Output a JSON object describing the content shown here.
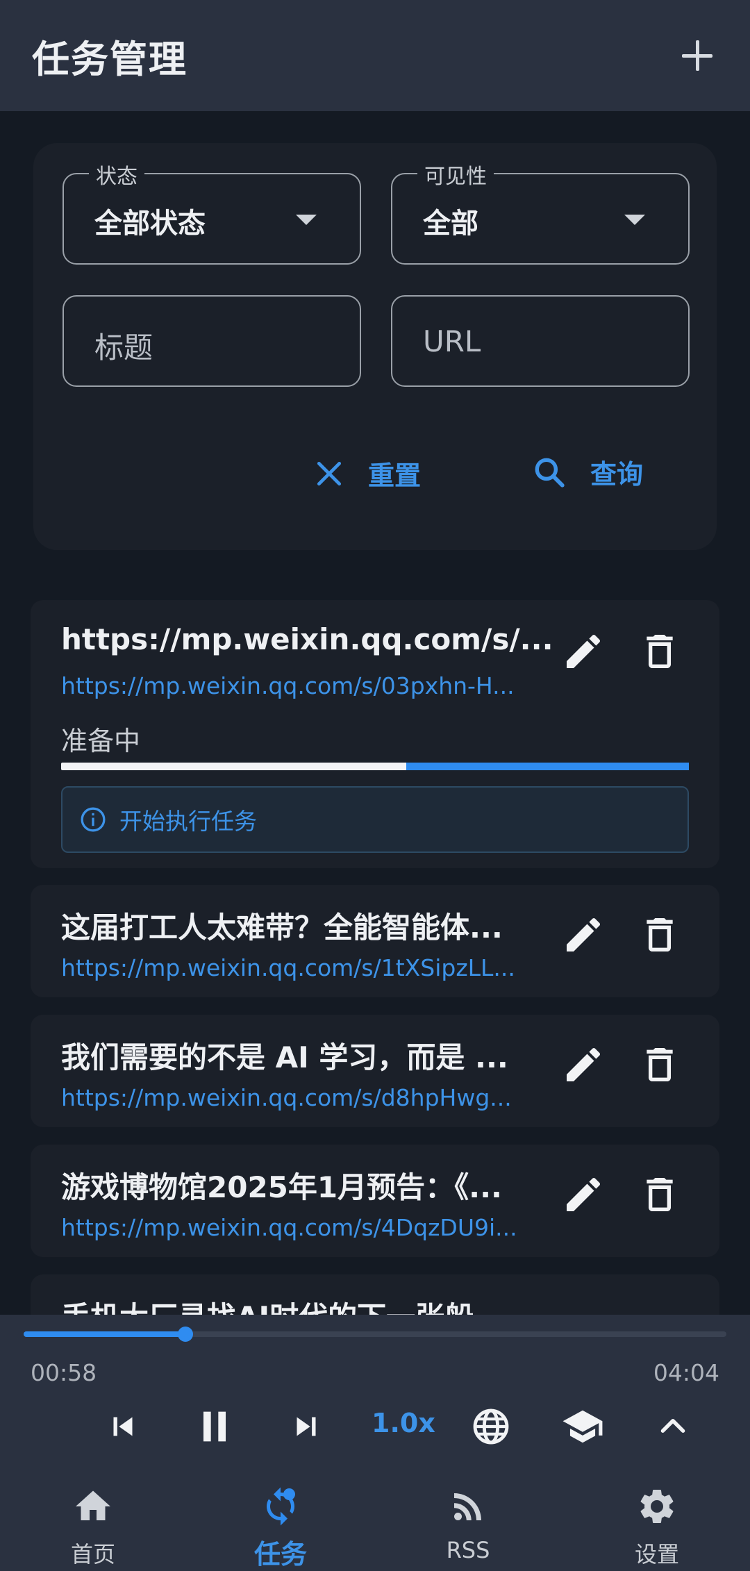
{
  "header": {
    "title": "任务管理",
    "add_icon": "plus-icon"
  },
  "filters": {
    "status": {
      "label": "状态",
      "value": "全部状态"
    },
    "visibility": {
      "label": "可见性",
      "value": "全部"
    },
    "title_input": {
      "placeholder": "标题"
    },
    "url_input": {
      "placeholder": "URL"
    },
    "reset_label": "重置",
    "search_label": "查询"
  },
  "tasks": [
    {
      "title": "https://mp.weixin.qq.com/s/...",
      "url": "https://mp.weixin.qq.com/s/03pxhn-H...",
      "status": "准备中",
      "progress": 0.55,
      "message": "开始执行任务"
    },
    {
      "title": "这届打工人太难带？全能智能体...",
      "url": "https://mp.weixin.qq.com/s/1tXSipzLL..."
    },
    {
      "title": "我们需要的不是 AI 学习，而是 ...",
      "url": "https://mp.weixin.qq.com/s/d8hpHwg..."
    },
    {
      "title": "游戏博物馆2025年1月预告：《...",
      "url": "https://mp.weixin.qq.com/s/4DqzDU9i..."
    },
    {
      "title": "手机大厂寻找AI时代的下一张船"
    }
  ],
  "player": {
    "elapsed": "00:58",
    "duration": "04:04",
    "progress": 0.23,
    "speed": "1.0x"
  },
  "nav": [
    {
      "label": "首页",
      "icon": "home-icon"
    },
    {
      "label": "任务",
      "icon": "sync-icon",
      "active": true
    },
    {
      "label": "RSS",
      "icon": "rss-icon"
    },
    {
      "label": "设置",
      "icon": "gear-icon"
    }
  ],
  "colors": {
    "accent": "#2f8cf0",
    "appbar": "#2a3140",
    "background": "#141a23",
    "card": "#1b2029"
  }
}
